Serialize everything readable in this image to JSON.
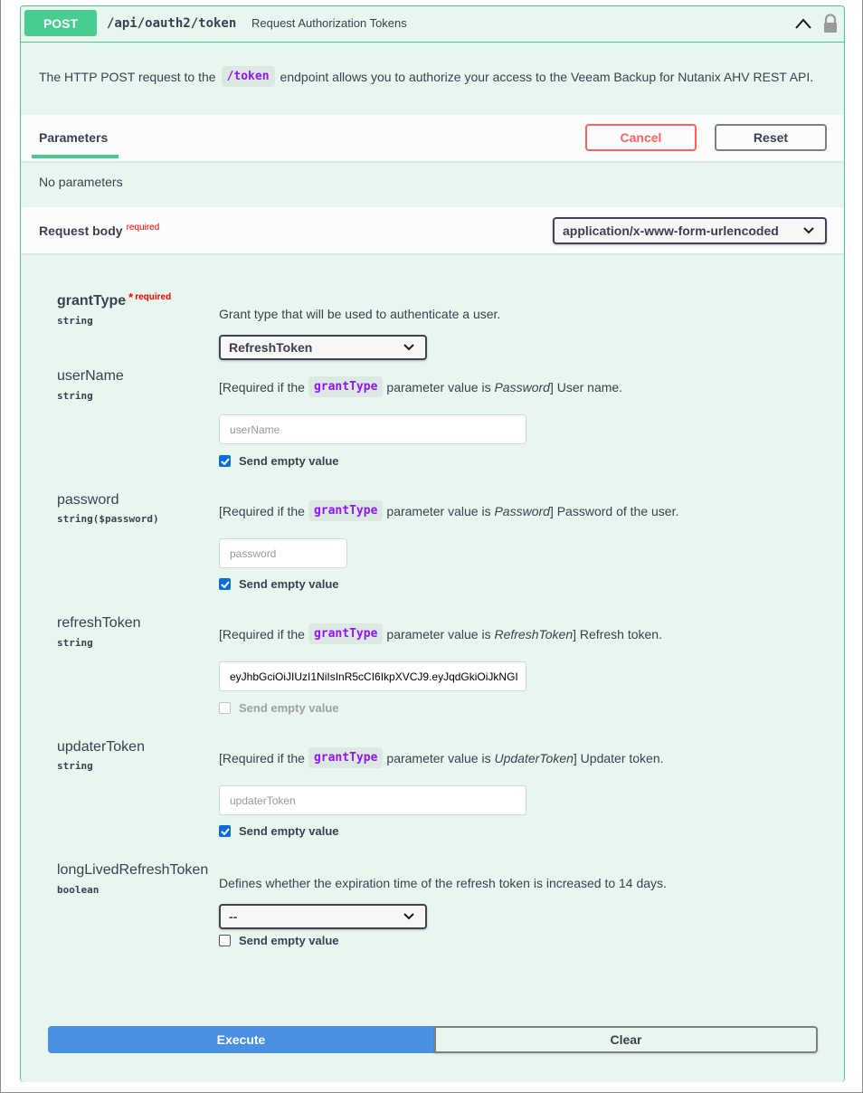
{
  "summary": {
    "method": "POST",
    "path": "/api/oauth2/token",
    "description": "Request Authorization Tokens"
  },
  "description": {
    "before": "The HTTP POST request to the",
    "code": "/token",
    "after": "endpoint allows you to authorize your access to the Veeam Backup for Nutanix AHV REST API."
  },
  "parameters": {
    "tab_label": "Parameters",
    "cancel_label": "Cancel",
    "reset_label": "Reset",
    "empty_text": "No parameters"
  },
  "request_body": {
    "title": "Request body",
    "required_label": "required",
    "content_type": "application/x-www-form-urlencoded"
  },
  "fields": {
    "grantType": {
      "name": "grantType",
      "star": "*",
      "required_label": "required",
      "type": "string",
      "description": "Grant type that will be used to authenticate a user.",
      "value": "RefreshToken"
    },
    "userName": {
      "name": "userName",
      "type": "string",
      "desc_before": "[Required if the",
      "desc_code": "grantType",
      "desc_mid": "parameter value is",
      "desc_italic": "Password",
      "desc_after": "] User name.",
      "placeholder": "userName",
      "send_empty_label": "Send empty value",
      "send_empty_checked": true
    },
    "password": {
      "name": "password",
      "type": "string($password)",
      "desc_before": "[Required if the",
      "desc_code": "grantType",
      "desc_mid": "parameter value is",
      "desc_italic": "Password",
      "desc_after": "] Password of the user.",
      "placeholder": "password",
      "send_empty_label": "Send empty value",
      "send_empty_checked": true
    },
    "refreshToken": {
      "name": "refreshToken",
      "type": "string",
      "desc_before": "[Required if the",
      "desc_code": "grantType",
      "desc_mid": "parameter value is",
      "desc_italic": "RefreshToken",
      "desc_after": "] Refresh token.",
      "value": "eyJhbGciOiJIUzI1NiIsInR5cCI6IkpXVCJ9.eyJqdGkiOiJkNGI",
      "send_empty_label": "Send empty value",
      "send_empty_checked": false,
      "send_empty_disabled": true
    },
    "updaterToken": {
      "name": "updaterToken",
      "type": "string",
      "desc_before": "[Required if the",
      "desc_code": "grantType",
      "desc_mid": "parameter value is",
      "desc_italic": "UpdaterToken",
      "desc_after": "] Updater token.",
      "placeholder": "updaterToken",
      "send_empty_label": "Send empty value",
      "send_empty_checked": true
    },
    "longLivedRefreshToken": {
      "name": "longLivedRefreshToken",
      "type": "boolean",
      "description": "Defines whether the expiration time of the refresh token is increased to 14 days.",
      "value": "--",
      "send_empty_label": "Send empty value",
      "send_empty_checked": false
    }
  },
  "actions": {
    "execute_label": "Execute",
    "clear_label": "Clear"
  },
  "colors": {
    "post_green": "#49cc90",
    "block_bg": "#e8f6f0",
    "cancel_red": "#ff6060",
    "execute_blue": "#4990e2",
    "code_purple": "#9012fe"
  }
}
